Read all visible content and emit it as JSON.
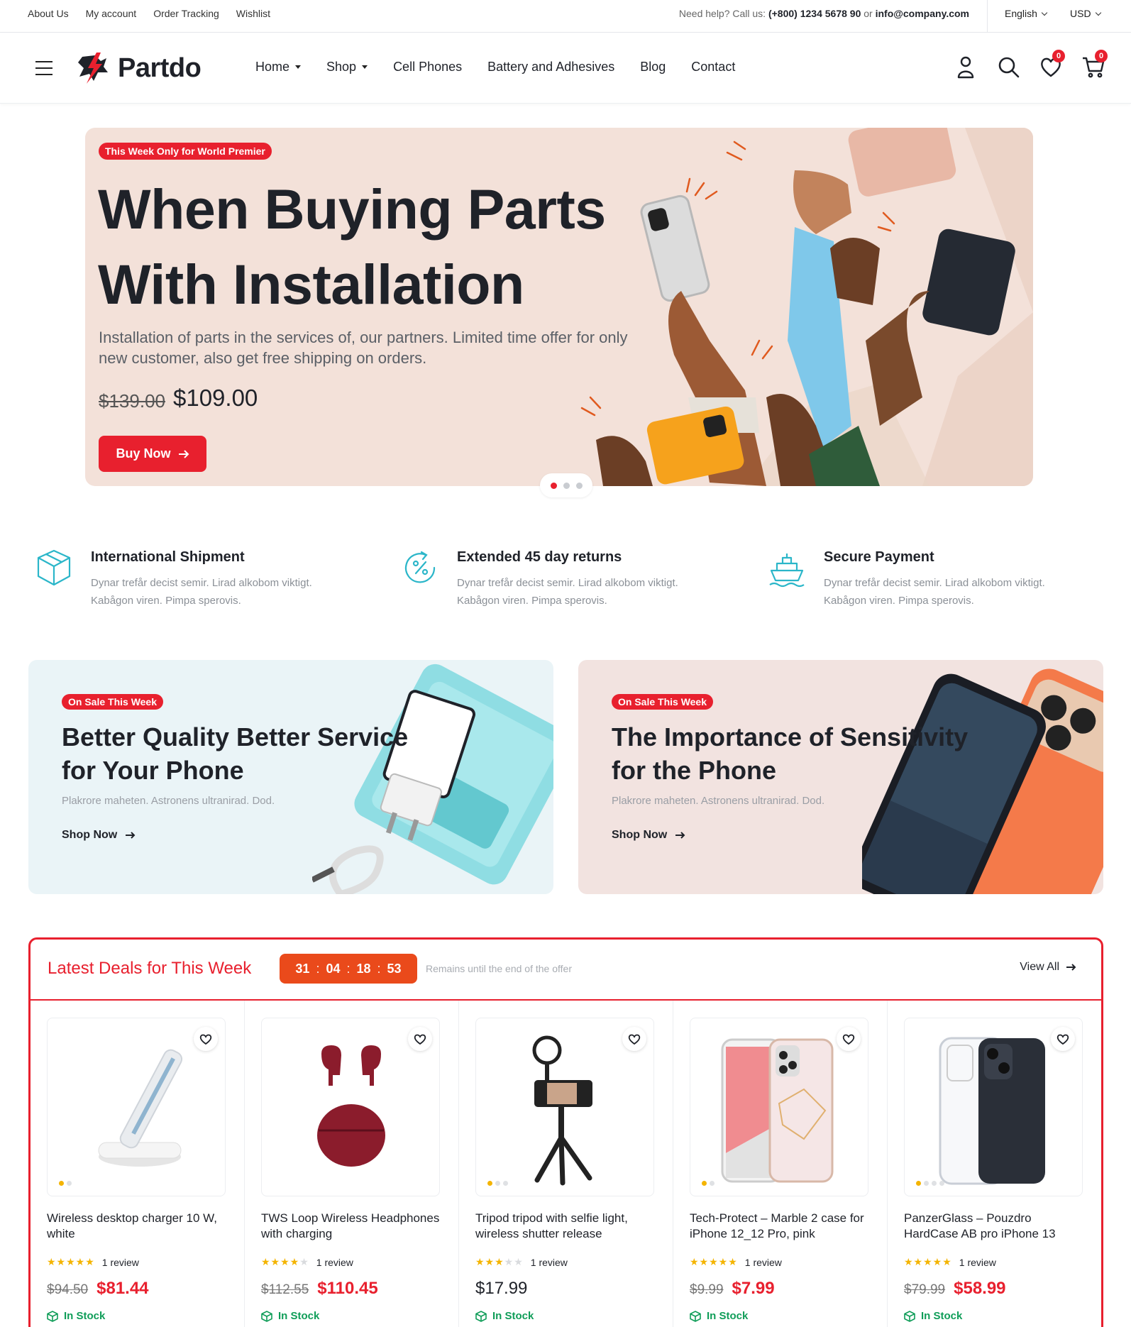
{
  "topbar": {
    "links": [
      "About Us",
      "My account",
      "Order Tracking",
      "Wishlist"
    ],
    "help_prefix": "Need help? Call us:",
    "phone": "(+800) 1234 5678 90",
    "or": "or",
    "email": "info@company.com",
    "language": "English",
    "currency": "USD"
  },
  "header": {
    "logo": "Partdo",
    "nav": [
      {
        "label": "Home",
        "dropdown": true
      },
      {
        "label": "Shop",
        "dropdown": true
      },
      {
        "label": "Cell Phones",
        "dropdown": false
      },
      {
        "label": "Battery and Adhesives",
        "dropdown": false
      },
      {
        "label": "Blog",
        "dropdown": false
      },
      {
        "label": "Contact",
        "dropdown": false
      }
    ],
    "wishlist_count": "0",
    "cart_count": "0"
  },
  "hero": {
    "tag": "This Week Only for World Premier",
    "title_line1": "When Buying Parts",
    "title_line2": "With Installation",
    "subtitle": "Installation of parts in the services of, our partners. Limited time offer for only new customer, also get free shipping on orders.",
    "old_price": "$139.00",
    "new_price": "$109.00",
    "cta": "Buy Now",
    "slides": 3,
    "active_slide": 1
  },
  "features": [
    {
      "icon": "box-icon",
      "title": "International Shipment",
      "desc": "Dynar trefår decist semir. Lirad alkobom viktigt. Kabågon viren. Pimpa sperovis."
    },
    {
      "icon": "percent-return-icon",
      "title": "Extended 45 day returns",
      "desc": "Dynar trefår decist semir. Lirad alkobom viktigt. Kabågon viren. Pimpa sperovis."
    },
    {
      "icon": "ship-icon",
      "title": "Secure Payment",
      "desc": "Dynar trefår decist semir. Lirad alkobom viktigt. Kabågon viren. Pimpa sperovis."
    }
  ],
  "promos": [
    {
      "tag": "On Sale This Week",
      "title": "Better Quality Better Service for Your Phone",
      "desc": "Plakrore maheten. Astronens ultranirad. Dod.",
      "link": "Shop Now"
    },
    {
      "tag": "On Sale This Week",
      "title": "The Importance of Sensitivity for the Phone",
      "desc": "Plakrore maheten. Astronens ultranirad. Dod.",
      "link": "Shop Now"
    }
  ],
  "deals": {
    "title": "Latest Deals for This Week",
    "timer": {
      "days": "31",
      "hours": "04",
      "minutes": "18",
      "seconds": "53"
    },
    "remains": "Remains until the end of the offer",
    "view_all": "View All",
    "products": [
      {
        "name": "Wireless desktop charger 10 W, white",
        "rating": 5,
        "reviews": "1 review",
        "old_price": "$94.50",
        "price": "$81.44",
        "stock": "In Stock",
        "images": 2
      },
      {
        "name": "TWS Loop Wireless Headphones with charging",
        "rating": 4,
        "reviews": "1 review",
        "old_price": "$112.55",
        "price": "$110.45",
        "stock": "In Stock",
        "images": 0
      },
      {
        "name": "Tripod tripod with selfie light, wireless shutter release",
        "rating": 3,
        "reviews": "1 review",
        "old_price": "",
        "price": "$17.99",
        "stock": "In Stock",
        "images": 3
      },
      {
        "name": "Tech-Protect – Marble 2 case for iPhone 12_12 Pro, pink",
        "rating": 5,
        "reviews": "1 review",
        "old_price": "$9.99",
        "price": "$7.99",
        "stock": "In Stock",
        "images": 2
      },
      {
        "name": "PanzerGlass – Pouzdro HardCase AB pro iPhone 13",
        "rating": 5,
        "reviews": "1 review",
        "old_price": "$79.99",
        "price": "$58.99",
        "stock": "In Stock",
        "images": 4
      }
    ]
  },
  "colors": {
    "accent": "#e8202e",
    "timer": "#ea4a1b",
    "stock": "#0f9d58",
    "star": "#f4b400",
    "feature_icon": "#2bb6c9"
  }
}
